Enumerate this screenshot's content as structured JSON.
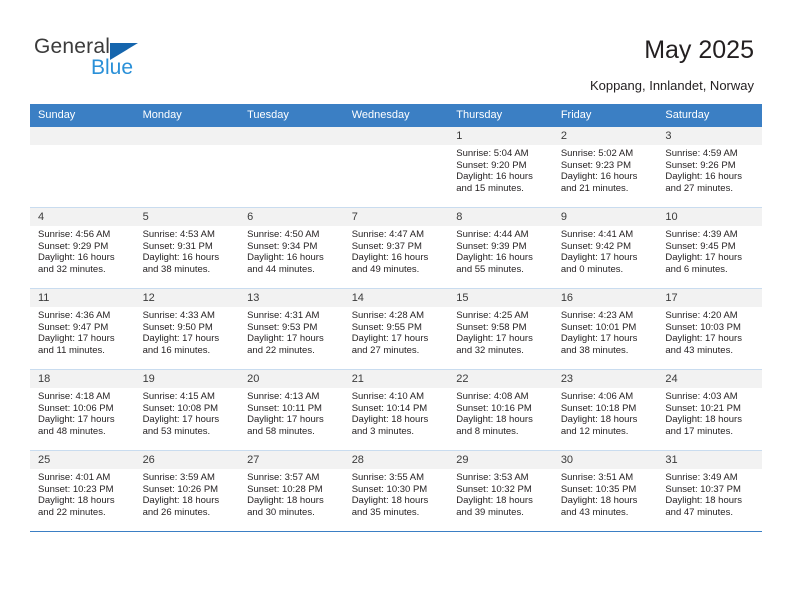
{
  "brand": {
    "line1": "General",
    "line2": "Blue",
    "triangle_color": "#1565ad",
    "line2_color": "#2a90d8"
  },
  "header": {
    "title": "May 2025",
    "subtitle": "Koppang, Innlandet, Norway"
  },
  "theme": {
    "header_row_bg": "#3b7fc4",
    "header_row_text": "#ffffff",
    "daynum_bg": "#f2f2f2",
    "rule_color": "#c9dcef"
  },
  "weekday_headers": [
    "Sunday",
    "Monday",
    "Tuesday",
    "Wednesday",
    "Thursday",
    "Friday",
    "Saturday"
  ],
  "labels": {
    "sunrise_prefix": "Sunrise:",
    "sunset_prefix": "Sunset:",
    "daylight_prefix": "Daylight:"
  },
  "weeks": [
    [
      {
        "day": "",
        "empty": true
      },
      {
        "day": "",
        "empty": true
      },
      {
        "day": "",
        "empty": true
      },
      {
        "day": "",
        "empty": true
      },
      {
        "day": "1",
        "sunrise": "Sunrise: 5:04 AM",
        "sunset": "Sunset: 9:20 PM",
        "daylight1": "Daylight: 16 hours",
        "daylight2": "and 15 minutes."
      },
      {
        "day": "2",
        "sunrise": "Sunrise: 5:02 AM",
        "sunset": "Sunset: 9:23 PM",
        "daylight1": "Daylight: 16 hours",
        "daylight2": "and 21 minutes."
      },
      {
        "day": "3",
        "sunrise": "Sunrise: 4:59 AM",
        "sunset": "Sunset: 9:26 PM",
        "daylight1": "Daylight: 16 hours",
        "daylight2": "and 27 minutes."
      }
    ],
    [
      {
        "day": "4",
        "sunrise": "Sunrise: 4:56 AM",
        "sunset": "Sunset: 9:29 PM",
        "daylight1": "Daylight: 16 hours",
        "daylight2": "and 32 minutes."
      },
      {
        "day": "5",
        "sunrise": "Sunrise: 4:53 AM",
        "sunset": "Sunset: 9:31 PM",
        "daylight1": "Daylight: 16 hours",
        "daylight2": "and 38 minutes."
      },
      {
        "day": "6",
        "sunrise": "Sunrise: 4:50 AM",
        "sunset": "Sunset: 9:34 PM",
        "daylight1": "Daylight: 16 hours",
        "daylight2": "and 44 minutes."
      },
      {
        "day": "7",
        "sunrise": "Sunrise: 4:47 AM",
        "sunset": "Sunset: 9:37 PM",
        "daylight1": "Daylight: 16 hours",
        "daylight2": "and 49 minutes."
      },
      {
        "day": "8",
        "sunrise": "Sunrise: 4:44 AM",
        "sunset": "Sunset: 9:39 PM",
        "daylight1": "Daylight: 16 hours",
        "daylight2": "and 55 minutes."
      },
      {
        "day": "9",
        "sunrise": "Sunrise: 4:41 AM",
        "sunset": "Sunset: 9:42 PM",
        "daylight1": "Daylight: 17 hours",
        "daylight2": "and 0 minutes."
      },
      {
        "day": "10",
        "sunrise": "Sunrise: 4:39 AM",
        "sunset": "Sunset: 9:45 PM",
        "daylight1": "Daylight: 17 hours",
        "daylight2": "and 6 minutes."
      }
    ],
    [
      {
        "day": "11",
        "sunrise": "Sunrise: 4:36 AM",
        "sunset": "Sunset: 9:47 PM",
        "daylight1": "Daylight: 17 hours",
        "daylight2": "and 11 minutes."
      },
      {
        "day": "12",
        "sunrise": "Sunrise: 4:33 AM",
        "sunset": "Sunset: 9:50 PM",
        "daylight1": "Daylight: 17 hours",
        "daylight2": "and 16 minutes."
      },
      {
        "day": "13",
        "sunrise": "Sunrise: 4:31 AM",
        "sunset": "Sunset: 9:53 PM",
        "daylight1": "Daylight: 17 hours",
        "daylight2": "and 22 minutes."
      },
      {
        "day": "14",
        "sunrise": "Sunrise: 4:28 AM",
        "sunset": "Sunset: 9:55 PM",
        "daylight1": "Daylight: 17 hours",
        "daylight2": "and 27 minutes."
      },
      {
        "day": "15",
        "sunrise": "Sunrise: 4:25 AM",
        "sunset": "Sunset: 9:58 PM",
        "daylight1": "Daylight: 17 hours",
        "daylight2": "and 32 minutes."
      },
      {
        "day": "16",
        "sunrise": "Sunrise: 4:23 AM",
        "sunset": "Sunset: 10:01 PM",
        "daylight1": "Daylight: 17 hours",
        "daylight2": "and 38 minutes."
      },
      {
        "day": "17",
        "sunrise": "Sunrise: 4:20 AM",
        "sunset": "Sunset: 10:03 PM",
        "daylight1": "Daylight: 17 hours",
        "daylight2": "and 43 minutes."
      }
    ],
    [
      {
        "day": "18",
        "sunrise": "Sunrise: 4:18 AM",
        "sunset": "Sunset: 10:06 PM",
        "daylight1": "Daylight: 17 hours",
        "daylight2": "and 48 minutes."
      },
      {
        "day": "19",
        "sunrise": "Sunrise: 4:15 AM",
        "sunset": "Sunset: 10:08 PM",
        "daylight1": "Daylight: 17 hours",
        "daylight2": "and 53 minutes."
      },
      {
        "day": "20",
        "sunrise": "Sunrise: 4:13 AM",
        "sunset": "Sunset: 10:11 PM",
        "daylight1": "Daylight: 17 hours",
        "daylight2": "and 58 minutes."
      },
      {
        "day": "21",
        "sunrise": "Sunrise: 4:10 AM",
        "sunset": "Sunset: 10:14 PM",
        "daylight1": "Daylight: 18 hours",
        "daylight2": "and 3 minutes."
      },
      {
        "day": "22",
        "sunrise": "Sunrise: 4:08 AM",
        "sunset": "Sunset: 10:16 PM",
        "daylight1": "Daylight: 18 hours",
        "daylight2": "and 8 minutes."
      },
      {
        "day": "23",
        "sunrise": "Sunrise: 4:06 AM",
        "sunset": "Sunset: 10:18 PM",
        "daylight1": "Daylight: 18 hours",
        "daylight2": "and 12 minutes."
      },
      {
        "day": "24",
        "sunrise": "Sunrise: 4:03 AM",
        "sunset": "Sunset: 10:21 PM",
        "daylight1": "Daylight: 18 hours",
        "daylight2": "and 17 minutes."
      }
    ],
    [
      {
        "day": "25",
        "sunrise": "Sunrise: 4:01 AM",
        "sunset": "Sunset: 10:23 PM",
        "daylight1": "Daylight: 18 hours",
        "daylight2": "and 22 minutes."
      },
      {
        "day": "26",
        "sunrise": "Sunrise: 3:59 AM",
        "sunset": "Sunset: 10:26 PM",
        "daylight1": "Daylight: 18 hours",
        "daylight2": "and 26 minutes."
      },
      {
        "day": "27",
        "sunrise": "Sunrise: 3:57 AM",
        "sunset": "Sunset: 10:28 PM",
        "daylight1": "Daylight: 18 hours",
        "daylight2": "and 30 minutes."
      },
      {
        "day": "28",
        "sunrise": "Sunrise: 3:55 AM",
        "sunset": "Sunset: 10:30 PM",
        "daylight1": "Daylight: 18 hours",
        "daylight2": "and 35 minutes."
      },
      {
        "day": "29",
        "sunrise": "Sunrise: 3:53 AM",
        "sunset": "Sunset: 10:32 PM",
        "daylight1": "Daylight: 18 hours",
        "daylight2": "and 39 minutes."
      },
      {
        "day": "30",
        "sunrise": "Sunrise: 3:51 AM",
        "sunset": "Sunset: 10:35 PM",
        "daylight1": "Daylight: 18 hours",
        "daylight2": "and 43 minutes."
      },
      {
        "day": "31",
        "sunrise": "Sunrise: 3:49 AM",
        "sunset": "Sunset: 10:37 PM",
        "daylight1": "Daylight: 18 hours",
        "daylight2": "and 47 minutes."
      }
    ]
  ]
}
